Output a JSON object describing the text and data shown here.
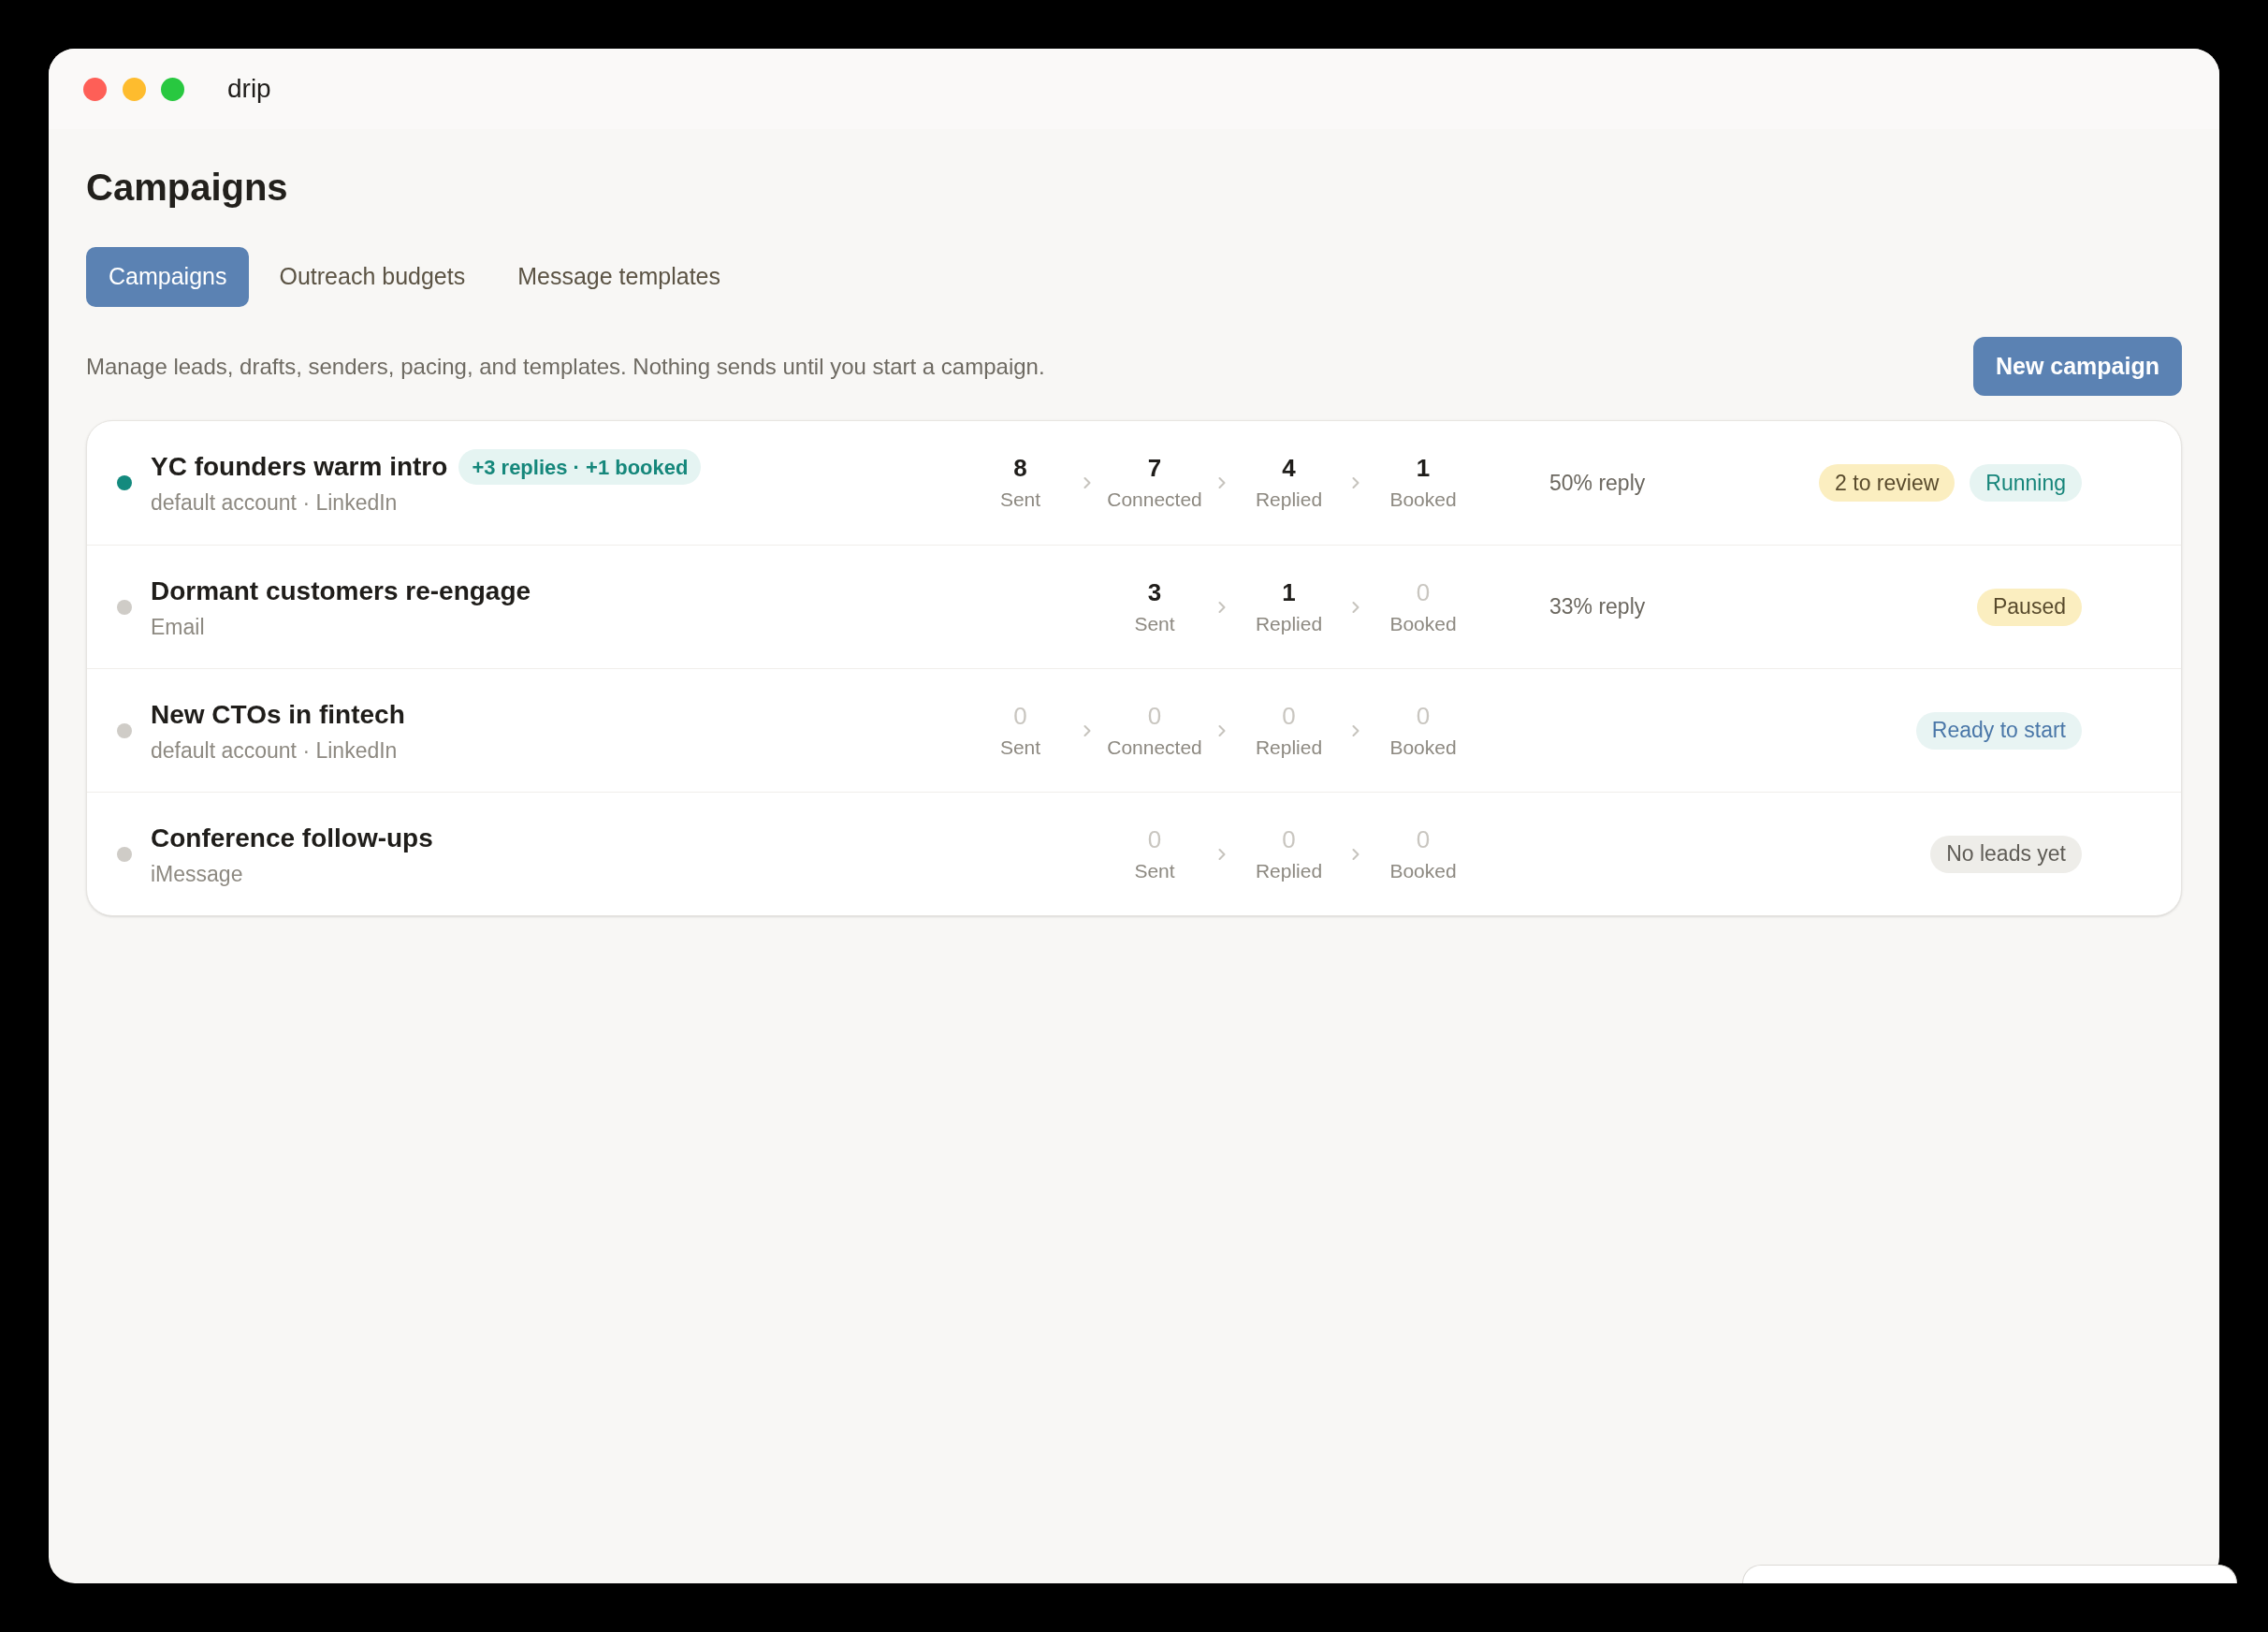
{
  "window": {
    "title": "drip"
  },
  "page": {
    "heading": "Campaigns",
    "description": "Manage leads, drafts, senders, pacing, and templates. Nothing sends until you start a campaign.",
    "primary_button": "New campaign"
  },
  "tabs": [
    {
      "label": "Campaigns",
      "selected": true
    },
    {
      "label": "Outreach budgets",
      "selected": false
    },
    {
      "label": "Message templates",
      "selected": false
    }
  ],
  "campaigns": [
    {
      "name": "YC founders warm intro",
      "activity": "+3 replies · +1 booked",
      "channel": "default account · LinkedIn",
      "color": "#138a7e",
      "stats": [
        {
          "value": "8",
          "label": "Sent",
          "empty": false
        },
        {
          "value": "7",
          "label": "Connected",
          "empty": false
        },
        {
          "value": "4",
          "label": "Replied",
          "empty": false
        },
        {
          "value": "1",
          "label": "Booked",
          "empty": false
        }
      ],
      "reply_rate": "50% reply",
      "badges": [
        {
          "label": "2 to review",
          "kind": "warning"
        },
        {
          "label": "Running",
          "kind": "active"
        }
      ]
    },
    {
      "name": "Dormant customers re-engage",
      "channel": "Email",
      "color": "#cfccc7",
      "stats": [
        {
          "value": "3",
          "label": "Sent",
          "empty": false
        },
        {
          "value": "1",
          "label": "Replied",
          "empty": false
        },
        {
          "value": "0",
          "label": "Booked",
          "empty": true
        }
      ],
      "reply_rate": "33% reply",
      "badges": [
        {
          "label": "Paused",
          "kind": "warning"
        }
      ]
    },
    {
      "name": "New CTOs in fintech",
      "channel": "default account · LinkedIn",
      "color": "#cfccc7",
      "stats": [
        {
          "value": "0",
          "label": "Sent",
          "empty": true
        },
        {
          "value": "0",
          "label": "Connected",
          "empty": true
        },
        {
          "value": "0",
          "label": "Replied",
          "empty": true
        },
        {
          "value": "0",
          "label": "Booked",
          "empty": true
        }
      ],
      "badges": [
        {
          "label": "Ready to start",
          "kind": "info"
        }
      ]
    },
    {
      "name": "Conference follow-ups",
      "channel": "iMessage",
      "color": "#cfccc7",
      "stats": [
        {
          "value": "0",
          "label": "Sent",
          "empty": true
        },
        {
          "value": "0",
          "label": "Replied",
          "empty": true
        },
        {
          "value": "0",
          "label": "Booked",
          "empty": true
        }
      ],
      "badges": [
        {
          "label": "No leads yet",
          "kind": "neutral"
        }
      ]
    }
  ]
}
